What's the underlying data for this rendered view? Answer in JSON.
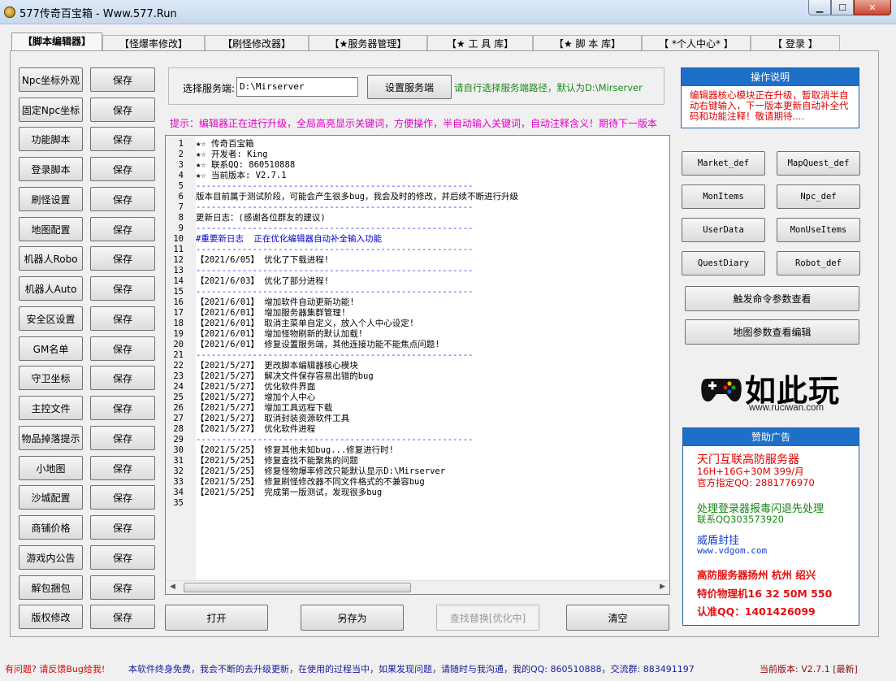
{
  "window": {
    "title": "577传奇百宝箱 - Www.577.Run",
    "min_label": "▁",
    "max_label": "☐",
    "close_label": "✕"
  },
  "tabs": [
    "【脚本编辑器】",
    "【怪爆率修改】",
    "【刷怪修改器】",
    "【★服务器管理】",
    "【★ 工 具 库】",
    "【★ 脚 本 库】",
    "【 *个人中心* 】",
    "【 登录 】"
  ],
  "left_buttons": [
    "Npc坐标外观",
    "固定Npc坐标",
    "功能脚本",
    "登录脚本",
    "刷怪设置",
    "地图配置",
    "机器人Robo",
    "机器人Auto",
    "安全区设置",
    "GM名单",
    "守卫坐标",
    "主控文件",
    "物品掉落提示",
    "小地图",
    "沙城配置",
    "商铺价格",
    "游戏内公告",
    "解包捆包",
    "版权修改"
  ],
  "save_label": "保存",
  "server": {
    "label": "选择服务端:",
    "path_value": "D:\\Mirserver",
    "set_button": "设置服务端",
    "hint": "请自行选择服务端路径，默认为D:\\Mirserver"
  },
  "tip": "提示：编辑器正在进行升级，全局高亮显示关键词，方便操作，半自动输入关键词，自动注释含义！期待下一版本",
  "editor": {
    "lines": [
      "★☆ 传奇百宝箱",
      "★☆ 开发者: King",
      "★☆ 联系QQ: 860510888",
      "★☆ 当前版本: V2.7.1",
      "------------------------------------------------------",
      "版本目前属于测试阶段，可能会产生很多bug，我会及时的修改，并后续不断进行升级",
      "------------------------------------------------------",
      "更新日志：(感谢各位群友的建议)",
      "------------------------------------------------------",
      "#重要新日志  正在优化编辑器自动补全输入功能",
      "------------------------------------------------------",
      "【2021/6/05】 优化了下载进程!",
      "------------------------------------------------------",
      "【2021/6/03】 优化了部分进程!",
      "------------------------------------------------------",
      "【2021/6/01】 增加软件自动更新功能!",
      "【2021/6/01】 增加服务器集群管理!",
      "【2021/6/01】 取消主菜单自定义，放入个人中心设定!",
      "【2021/6/01】 增加怪物刷新的默认加载!",
      "【2021/6/01】 修复设置服务端，其他连接功能不能焦点问题!",
      "------------------------------------------------------",
      "【2021/5/27】 更改脚本编辑器核心模块",
      "【2021/5/27】 解决文件保存容易出错的bug",
      "【2021/5/27】 优化软件界面",
      "【2021/5/27】 增加个人中心",
      "【2021/5/27】 增加工具远程下载",
      "【2021/5/27】 取消封装资源软件工具",
      "【2021/5/27】 优化软件进程",
      "------------------------------------------------------",
      "【2021/5/25】 修复其他未知bug...修复进行时!",
      "【2021/5/25】 修复查找不能聚焦的问题",
      "【2021/5/25】 修复怪物爆率修改只能默认显示D:\\Mirserver",
      "【2021/5/25】 修复刷怪修改器不同文件格式的不兼容bug",
      "【2021/5/25】 完成第一版测试，发现很多bug",
      ""
    ],
    "line_numbers": [
      "1",
      "2",
      "3",
      "4",
      "5",
      "6",
      "7",
      "8",
      "9",
      "10",
      "11",
      "12",
      "13",
      "14",
      "15",
      "16",
      "17",
      "18",
      "19",
      "20",
      "21",
      "22",
      "23",
      "24",
      "25",
      "26",
      "27",
      "28",
      "29",
      "30",
      "31",
      "32",
      "33",
      "34",
      "35"
    ]
  },
  "bottom_buttons": {
    "open": "打开",
    "save_as": "另存为",
    "find_replace": "查找替换[优化中]",
    "clear": "清空"
  },
  "ops": {
    "title": "操作说明",
    "text": "编辑器核心模块正在升级，暂取消半自动右键输入，下一版本更新自动补全代码和功能注释！敬请期待...."
  },
  "right_buttons": [
    "Market_def",
    "MapQuest_def",
    "MonItems",
    "Npc_def",
    "UserData",
    "MonUseItems",
    "QuestDiary",
    "Robot_def"
  ],
  "wide_buttons": [
    "触发命令参数查看",
    "地图参数查看编辑"
  ],
  "logo": {
    "text": "如此玩",
    "url": "www.ruciwan.com"
  },
  "ad": {
    "title": "赞助广告",
    "lines": [
      "天门互联高防服务器",
      "16H+16G+30M 399/月",
      "官方指定QQ: 2881776970",
      "处理登录器报毒闪退先处理",
      "联系QQ303573920",
      "威盾封挂",
      "www.vdgom.com",
      "高防服务器扬州 杭州 绍兴",
      "特价物理机16 32 50M 550",
      "认准QQ：1401426099"
    ]
  },
  "status": {
    "problem": "有问题? 请反馈Bug给我!",
    "info": "本软件终身免费，我会不断的去升级更新，在使用的过程当中，如果发现问题，请随时与我沟通，我的QQ: 860510888，交流群: 883491197",
    "version": "当前版本: V2.7.1 [最新]"
  },
  "colors": {
    "accent_blue": "#1e6fc8",
    "tip_magenta": "#e000c8",
    "hint_green": "#1a8a1a",
    "warn_red": "#e00000"
  }
}
